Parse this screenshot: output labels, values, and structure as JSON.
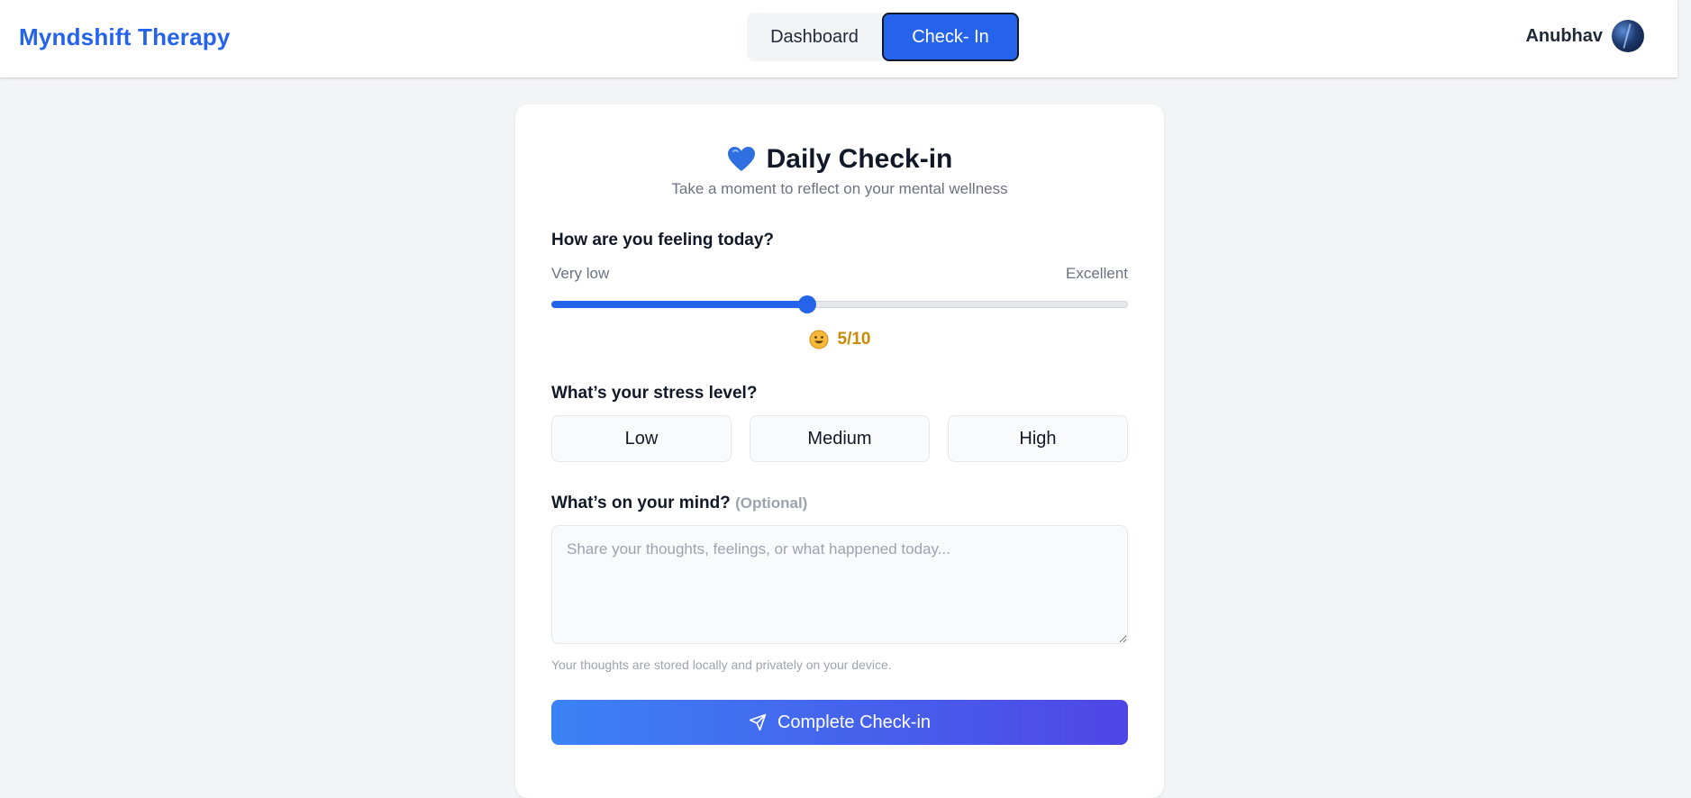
{
  "header": {
    "brand": "Myndshift Therapy",
    "tabs": [
      {
        "label": "Dashboard",
        "active": false
      },
      {
        "label": "Check- In",
        "active": true
      }
    ],
    "user": {
      "name": "Anubhav",
      "avatar_icon": "avatar-image"
    }
  },
  "checkin": {
    "title_icon": "blue-heart-icon",
    "title": "Daily Check-in",
    "subtitle": "Take a moment to reflect on your mental wellness",
    "mood": {
      "label": "How are you feeling today?",
      "low_label": "Very low",
      "high_label": "Excellent",
      "value": 5,
      "max": 10,
      "value_display": "5/10",
      "emoji_icon": "smiling-face-icon"
    },
    "stress": {
      "label": "What’s your stress level?",
      "options": [
        "Low",
        "Medium",
        "High"
      ]
    },
    "thoughts": {
      "label": "What’s on your mind?",
      "optional_label": "(Optional)",
      "placeholder": "Share your thoughts, feelings, or what happened today...",
      "value": ""
    },
    "privacy_note": "Your thoughts are stored locally and privately on your device.",
    "submit": {
      "label": "Complete Check-in",
      "icon": "send-icon"
    }
  },
  "colors": {
    "accent": "#2563eb",
    "mood_value": "#ca8a04",
    "submit_gradient_start": "#3b82f6",
    "submit_gradient_end": "#4f46e5",
    "page_background": "#f3f4f6"
  }
}
